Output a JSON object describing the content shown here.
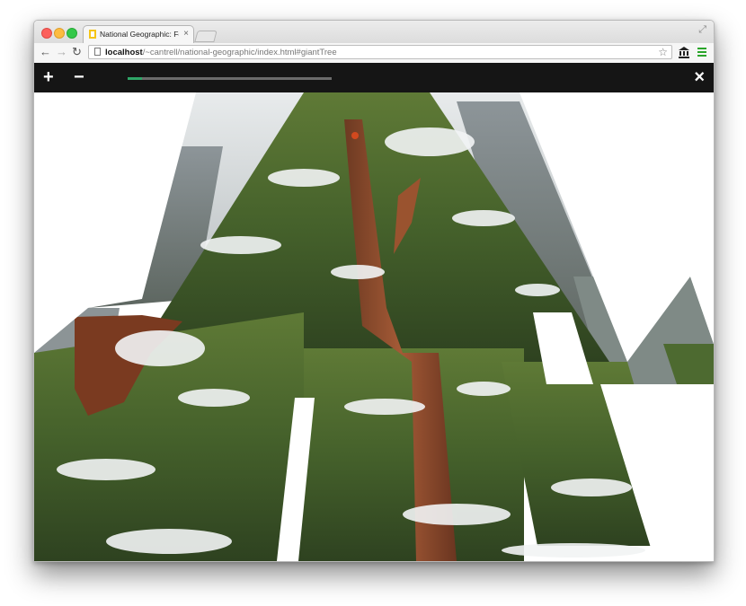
{
  "browser": {
    "tab_title": "National Geographic: Fore",
    "tab_close": "×",
    "url_host": "localhost",
    "url_path": "/~cantrell/national-geographic/index.html#giantTree",
    "back_icon": "←",
    "forward_icon": "→",
    "reload_icon": "↻",
    "star_icon": "☆",
    "fullscreen_icon": "⤢"
  },
  "app": {
    "zoom_in_label": "+",
    "zoom_out_label": "−",
    "close_label": "×",
    "progress": 0.07,
    "progress_color": "#2fa667"
  },
  "image": {
    "subject": "snow-covered giant tree viewed from below, photo tiles assembling in perspective"
  }
}
